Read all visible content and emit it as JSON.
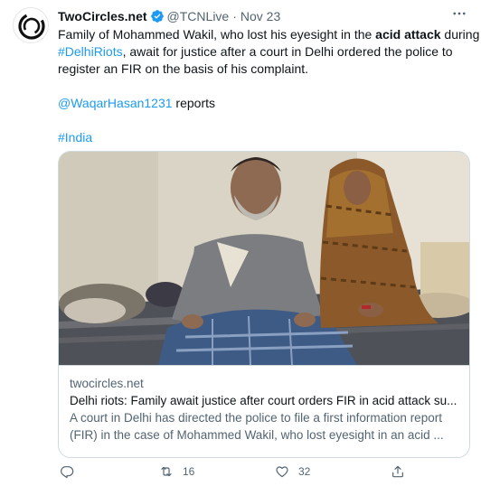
{
  "author": {
    "name": "TwoCircles.net",
    "handle": "@TCNLive",
    "separator": "·",
    "date": "Nov 23"
  },
  "tweet": {
    "line1_a": "Family of Mohammed Wakil, who lost his eyesight in the ",
    "line1_bold": "acid attack",
    "line1_b": " during",
    "hashtag_riots": "#DelhiRiots",
    "line2_b": ", await for justice after a court in Delhi ordered the police to",
    "line3": "register an FIR on the basis of his complaint.",
    "mention": "@WaqarHasan1231",
    "mention_suffix": " reports",
    "hashtag_india": "#India"
  },
  "card": {
    "domain": "twocircles.net",
    "title": "Delhi riots: Family await justice after court orders FIR in acid attack su...",
    "desc_line1": "A court in Delhi has directed the police to file a first information report",
    "desc_line2": "(FIR) in the case of Mohammed Wakil, who lost eyesight in an acid ..."
  },
  "actions": {
    "reply_count": "",
    "retweet_count": "16",
    "like_count": "32"
  },
  "icons": {
    "verified": "verified-badge-icon",
    "more": "more-horizontal-icon",
    "reply": "reply-icon",
    "retweet": "retweet-icon",
    "like": "heart-icon",
    "share": "share-icon"
  },
  "colors": {
    "link": "#1d9bf0",
    "secondary_text": "#536471",
    "border": "#cfd9de"
  }
}
